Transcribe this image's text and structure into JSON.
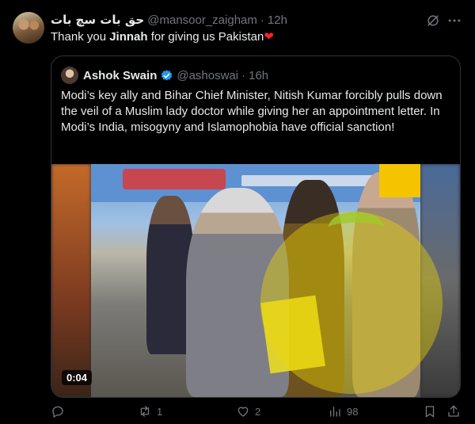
{
  "tweet": {
    "display_name": "حق بات سچ بات",
    "handle": "@mansoor_zaigham",
    "separator": "·",
    "time": "12h",
    "text_before": "Thank you ",
    "text_bold": "Jinnah",
    "text_after": " for giving us Pakistan",
    "emoji": "❤"
  },
  "quote": {
    "display_name": "Ashok Swain",
    "handle": "@ashoswai",
    "separator": "·",
    "time": "16h",
    "text": "Modi’s key ally and Bihar Chief Minister, Nitish Kumar forcibly pulls down the veil of a Muslim lady doctor while giving her an appointment letter. In Modi’s India, misogyny and Islamophobia have official sanction!",
    "video_duration": "0:04"
  },
  "actions": {
    "replies": "",
    "retweets": "1",
    "likes": "2",
    "views": "98"
  },
  "icons": {
    "grok": "grok-icon",
    "more": "more-icon",
    "verified": "verified-badge-icon",
    "reply": "reply-icon",
    "retweet": "retweet-icon",
    "like": "heart-icon",
    "views": "views-icon",
    "bookmark": "bookmark-icon",
    "share": "share-icon"
  },
  "colors": {
    "background": "#000000",
    "text": "#e7e9ea",
    "muted": "#71767b",
    "verified": "#1d9bf0",
    "heart": "#f4212e",
    "border": "#2f3336"
  }
}
